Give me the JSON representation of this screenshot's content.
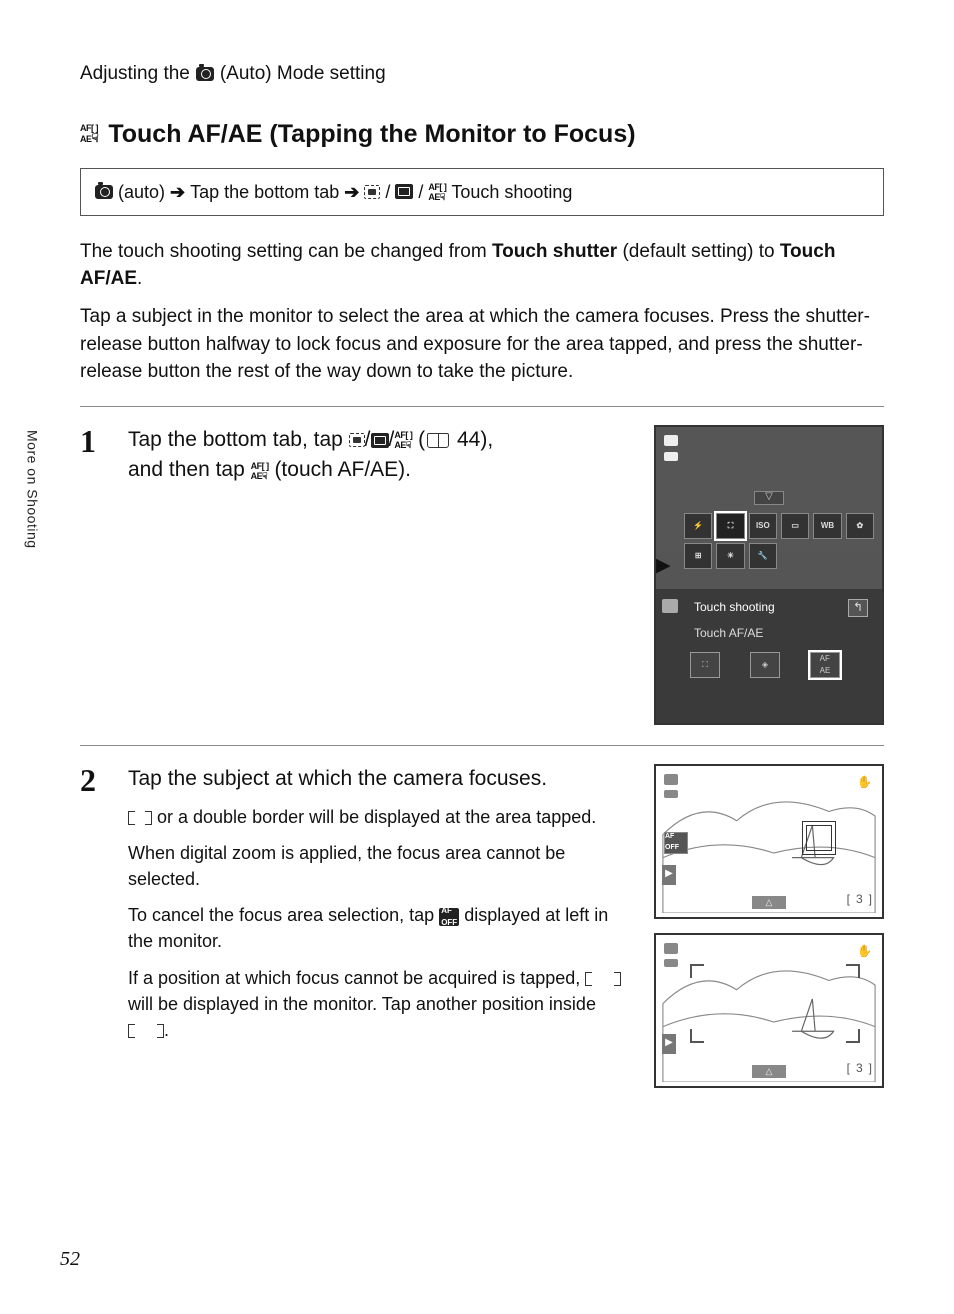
{
  "header": {
    "prefix": "Adjusting the",
    "mode_label": "(Auto) Mode setting"
  },
  "title": "Touch AF/AE (Tapping the Monitor to Focus)",
  "path": {
    "mode": "(auto)",
    "arrow": "➔",
    "step1": "Tap the bottom tab",
    "suffix": "Touch shooting"
  },
  "intro": {
    "p1a": "The touch shooting setting can be changed from ",
    "p1b": "Touch shutter",
    "p1c": " (default setting) to ",
    "p1d": "Touch AF/AE",
    "p1e": ".",
    "p2": "Tap a subject in the monitor to select the area at which the camera focuses. Press the shutter-release button halfway to lock focus and exposure for the area tapped, and press the shutter-release button the rest of the way down to take the picture."
  },
  "steps": {
    "s1": {
      "num": "1",
      "head_a": "Tap the bottom tab, tap ",
      "head_b": " (",
      "head_ref": " 44),",
      "head_c": "and then tap ",
      "head_d": " (touch AF/AE)."
    },
    "s2": {
      "num": "2",
      "head": "Tap the subject at which the camera focuses.",
      "p1a": "",
      "p1b": " or a double border will be displayed at the area tapped.",
      "p2": "When digital zoom is applied, the focus area cannot be selected.",
      "p3a": "To cancel the focus area selection, tap ",
      "p3b": " displayed at left in the monitor.",
      "p4a": "If a position at which focus cannot be acquired is tapped, ",
      "p4b": " will be displayed in the monitor. Tap another position inside ",
      "p4c": "."
    }
  },
  "figure1": {
    "menu_title": "Touch shooting",
    "menu_sub": "Touch AF/AE",
    "grid": [
      "",
      "",
      "ISO",
      "",
      "WB",
      "",
      "",
      "",
      "",
      "",
      ""
    ],
    "opts": [
      "",
      "",
      "AF[]\nAE"
    ]
  },
  "figure2": {
    "af_off_label": "AF\nOFF",
    "counter": "3",
    "bracket": "["
  },
  "side_tab": "More on Shooting",
  "page_number": "52"
}
